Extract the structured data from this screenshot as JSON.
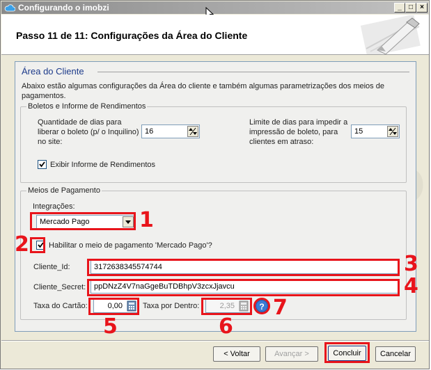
{
  "window": {
    "title": "Configurando o imobzi"
  },
  "header": {
    "title": "Passo 11 de 11: Configurações da Área do Cliente"
  },
  "watermark": "DEMO VERSION",
  "section": {
    "title": "Área do Cliente",
    "intro": "Abaixo estão algumas configurações da Área do cliente e também algumas parametrizações dos meios de pagamentos."
  },
  "boletos": {
    "legend": "Boletos e Informe de Rendimentos",
    "dias_label_1": "Quantidade de dias para",
    "dias_label_2": "liberar o boleto (p/ o Inquilino)",
    "dias_label_3": "no site:",
    "dias_value": "16",
    "limite_label_1": "Limite de dias para impedir a",
    "limite_label_2": "impressão de boleto, para",
    "limite_label_3": "clientes em atraso:",
    "limite_value": "15",
    "exibir_label": "Exibir Informe de Rendimentos",
    "exibir_checked": true
  },
  "pagamento": {
    "legend": "Meios de Pagamento",
    "integracoes_label": "Integrações:",
    "integracao_selected": "Mercado Pago",
    "habilitar_label": "Habilitar o meio de pagamento 'Mercado Pago'?",
    "habilitar_checked": true,
    "cliente_id_label": "Cliente_Id:",
    "cliente_id_value": "3172638345574744",
    "cliente_secret_label": "Cliente_Secret:",
    "cliente_secret_value": "ppDNzZ4V7naGgeBuTDBhpV3zcxJjavcu",
    "taxa_cartao_label": "Taxa do Cartão:",
    "taxa_cartao_value": "0,00",
    "taxa_dentro_label": "Taxa por Dentro:",
    "taxa_dentro_value": "2,35"
  },
  "annotations": {
    "n1": "1",
    "n2": "2",
    "n3": "3",
    "n4": "4",
    "n5": "5",
    "n6": "6",
    "n7": "7",
    "color": "#e8141b"
  },
  "help_icon": {
    "glyph": "?"
  },
  "buttons": {
    "voltar": "< Voltar",
    "avancar": "Avançar >",
    "concluir": "Concluir",
    "cancelar": "Cancelar"
  },
  "titlebar_buttons": {
    "minimize": "_",
    "maximize": "□",
    "close": "×"
  }
}
